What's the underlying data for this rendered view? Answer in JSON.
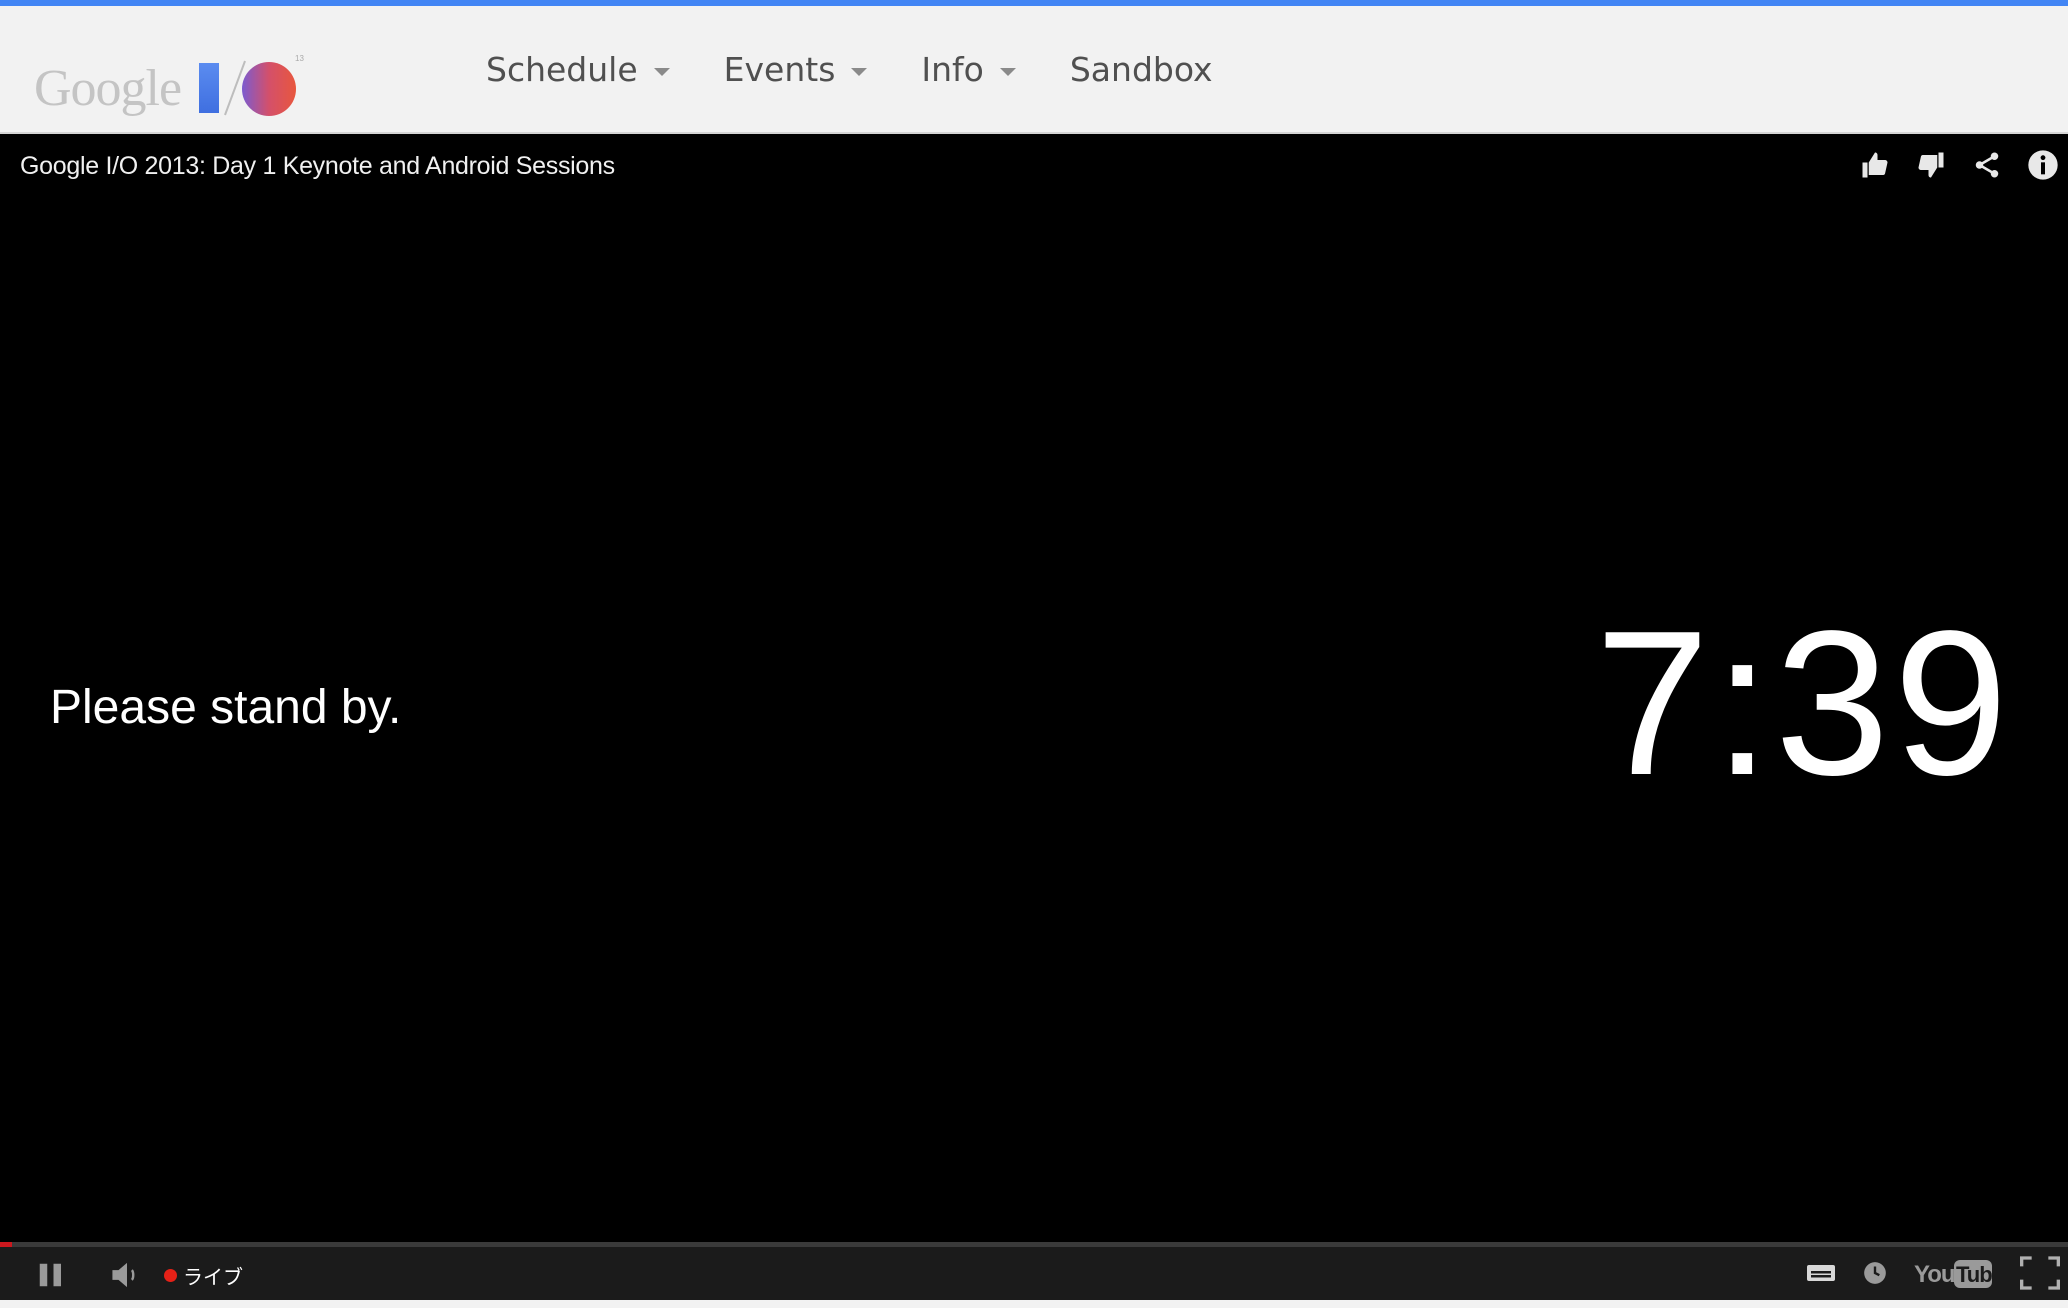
{
  "header": {
    "logo_text": "Google",
    "nav": [
      {
        "label": "Schedule",
        "has_dropdown": true
      },
      {
        "label": "Events",
        "has_dropdown": true
      },
      {
        "label": "Info",
        "has_dropdown": true
      },
      {
        "label": "Sandbox",
        "has_dropdown": false
      }
    ]
  },
  "player": {
    "title": "Google I/O 2013: Day 1 Keynote and Android Sessions",
    "actions": [
      "thumbs-up-icon",
      "thumbs-down-icon",
      "share-icon",
      "info-icon"
    ],
    "standby_text": "Please stand by.",
    "countdown": "7:39"
  },
  "controls": {
    "live_label": "ライブ",
    "progress_fraction": 0.006
  },
  "colors": {
    "accent": "#4285f4",
    "live": "#e62117",
    "progress": "#cc181e"
  }
}
